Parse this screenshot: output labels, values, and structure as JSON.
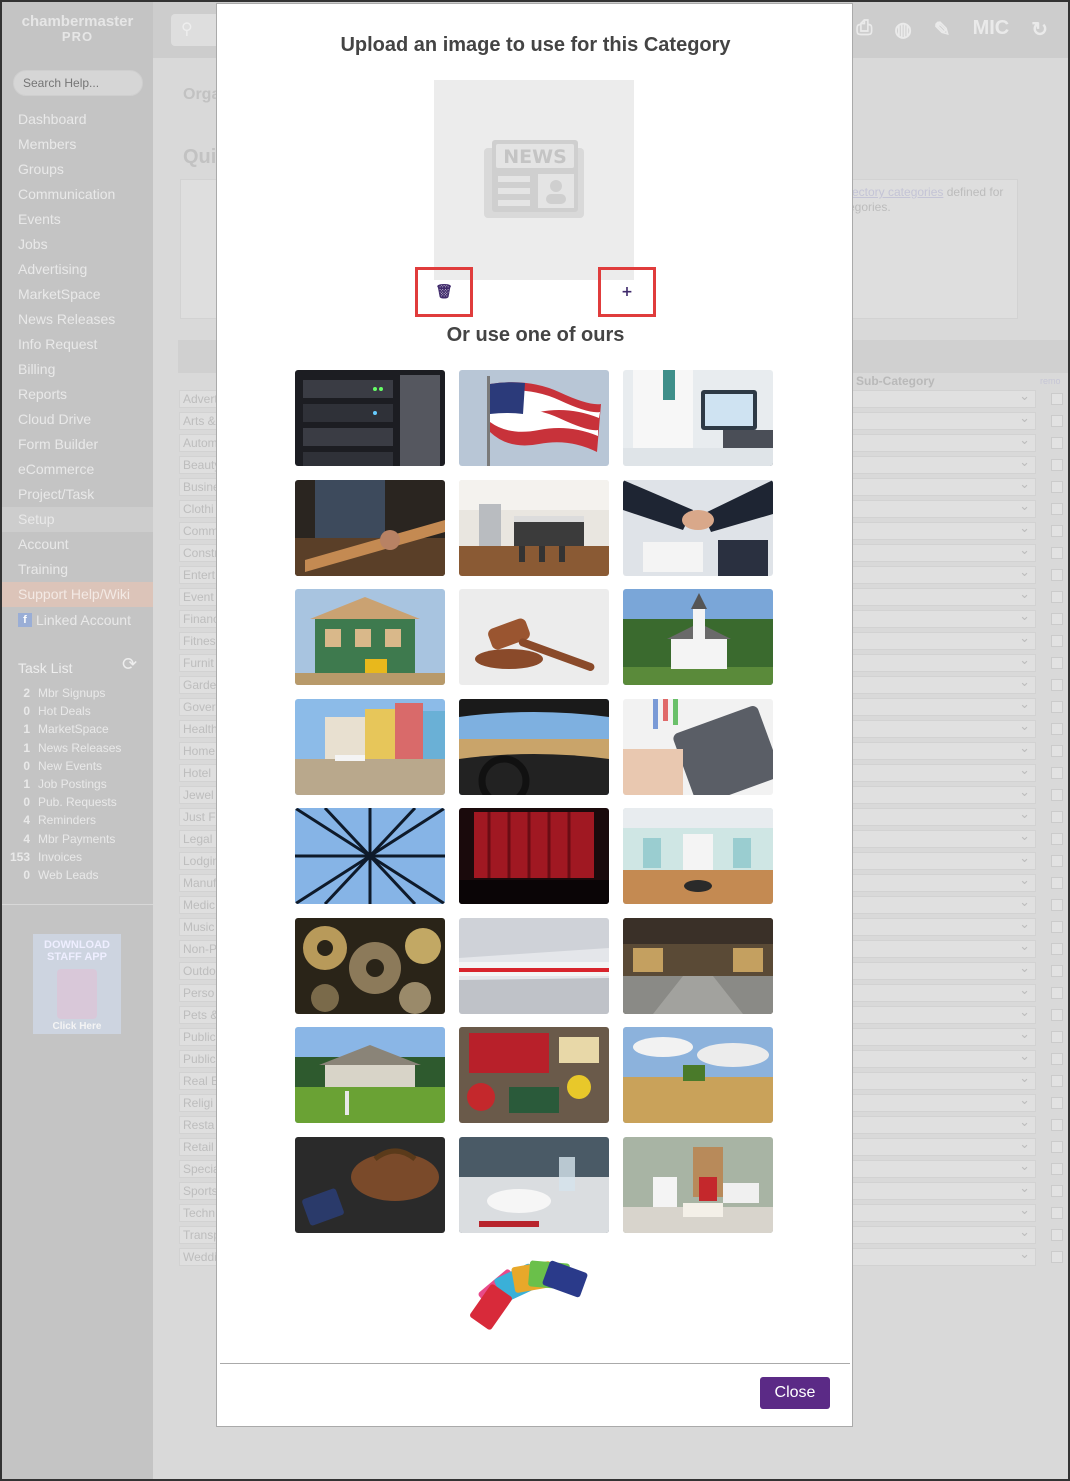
{
  "sidebar": {
    "logo_line1": "chambermaster",
    "logo_line2": "PRO",
    "search_placeholder": "Search Help...",
    "nav": [
      "Dashboard",
      "Members",
      "Groups",
      "Communication",
      "Events",
      "Jobs",
      "Advertising",
      "MarketSpace",
      "News Releases",
      "Info Request",
      "Billing",
      "Reports",
      "Cloud Drive",
      "Form Builder",
      "eCommerce",
      "Project/Task",
      "Setup",
      "Account",
      "Training",
      "Support Help/Wiki"
    ],
    "linked_account": "Linked Account",
    "task_list_title": "Task List",
    "tasks": [
      {
        "count": "2",
        "label": "Mbr Signups"
      },
      {
        "count": "0",
        "label": "Hot Deals"
      },
      {
        "count": "1",
        "label": "MarketSpace"
      },
      {
        "count": "1",
        "label": "News Releases"
      },
      {
        "count": "0",
        "label": "New Events"
      },
      {
        "count": "1",
        "label": "Job Postings"
      },
      {
        "count": "0",
        "label": "Pub. Requests"
      },
      {
        "count": "4",
        "label": "Reminders"
      },
      {
        "count": "4",
        "label": "Mbr Payments"
      },
      {
        "count": "153",
        "label": "Invoices"
      },
      {
        "count": "0",
        "label": "Web Leads"
      }
    ],
    "app_promo_line1": "DOWNLOAD STAFF APP",
    "app_promo_line2": "Click Here"
  },
  "topbar": {
    "mic_label": "MIC"
  },
  "background": {
    "breadcrumb": "Orga",
    "heading": "Qui",
    "link_text": "rectory categories",
    "link_suffix": " defined for",
    "line2": "egories.",
    "sub_category_header": "Sub-Category",
    "remove_header": "remo",
    "rows": [
      "Advert",
      "Arts &",
      "Autom",
      "Beauty",
      "Busine",
      "Clothi",
      "Comm",
      "Constr",
      "Entert",
      "Event",
      "Financ",
      "Fitnes",
      "Furnit",
      "Garde",
      "Gover",
      "Health",
      "Home",
      "Hotel",
      "Jewel",
      "Just F",
      "Legal",
      "Lodgin",
      "Manuf",
      "Medic",
      "Music",
      "Non-P",
      "Outdo",
      "Perso",
      "Pets &",
      "Public",
      "Public",
      "Real E",
      "Religi",
      "Resta",
      "Retail",
      "Specia",
      "Sports",
      "Techn",
      "Transp",
      "Weddi"
    ]
  },
  "modal": {
    "title": "Upload an image to use for this Category",
    "preview_icon": "news-placeholder-icon",
    "delete_icon": "trash-icon",
    "add_icon": "plus-icon",
    "delete_glyph": "🗑",
    "add_glyph": "+",
    "or_title": "Or use one of ours",
    "close_label": "Close",
    "accent_color": "#5b2a86",
    "highlight_color": "#e03c3c",
    "images": [
      "servers",
      "american-flag",
      "doctor-tablet",
      "woodworking",
      "kitchen",
      "handshake",
      "house-construction",
      "gavel",
      "church",
      "town-square",
      "driving",
      "calculator",
      "power-tower",
      "theater-curtain",
      "salon",
      "gears",
      "train-station",
      "warehouse",
      "ranch-house",
      "vintage-signs",
      "wheat-field",
      "travel-bag",
      "restaurant-table",
      "takeout-containers",
      "gift-cards"
    ]
  }
}
